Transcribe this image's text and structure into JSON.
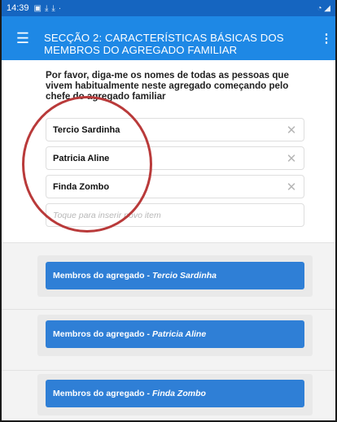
{
  "status_bar": {
    "time": "14:39",
    "icons": [
      "image-icon",
      "download-icon",
      "download-icon"
    ],
    "right_icons": "signal-icon"
  },
  "app_bar": {
    "menu_icon": "hamburger-menu-icon",
    "title": "SECÇÃO 2: CARACTERÍSTICAS BÁSICAS DOS MEMBROS DO AGREGADO FAMILIAR",
    "more_icon": "more-vert-icon"
  },
  "question": "Por favor, diga-me os nomes de todas as pessoas que vivem habitualmente neste agregado começando pelo chefe do agregado familiar",
  "items": [
    {
      "value": "Tercio Sardinha"
    },
    {
      "value": "Patricia Aline"
    },
    {
      "value": "Finda Zombo"
    }
  ],
  "new_item_placeholder": "Toque para inserir novo item",
  "groups": [
    {
      "label": "Membros do agregado - ",
      "name": "Tercio Sardinha"
    },
    {
      "label": "Membros do agregado - ",
      "name": "Patricia Aline"
    },
    {
      "label": "Membros do agregado - ",
      "name": "Finda Zombo"
    }
  ],
  "colors": {
    "status_bar": "#1565c0",
    "app_bar": "#1e88e5",
    "group_button": "#2f7fd6",
    "annotation": "#b93a3a"
  }
}
